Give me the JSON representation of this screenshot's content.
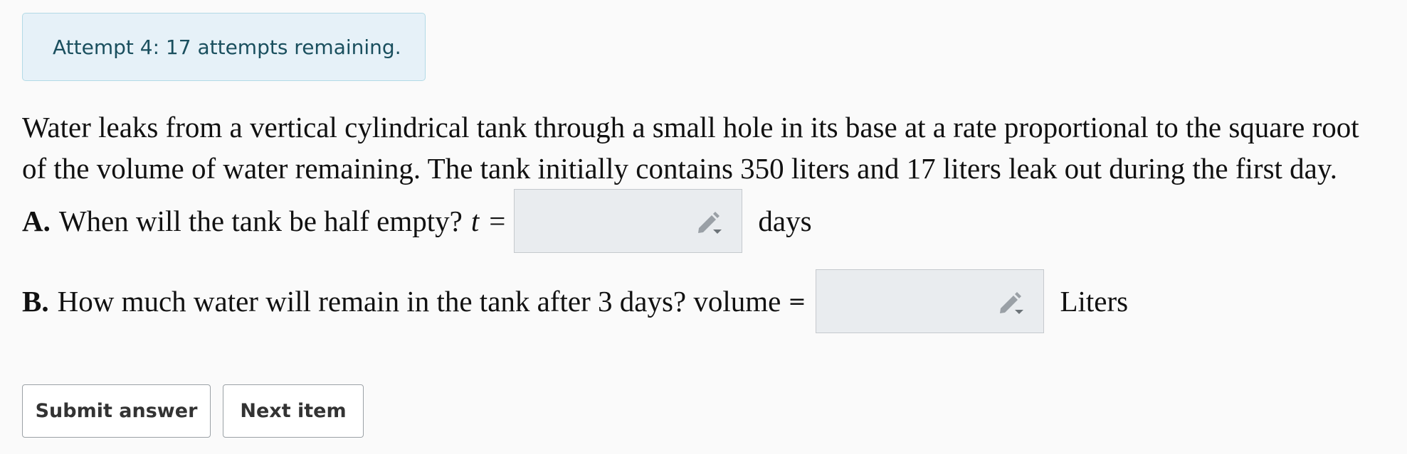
{
  "attempt_banner": {
    "text": "Attempt 4: 17 attempts remaining."
  },
  "problem": {
    "intro_line1": "Water leaks from a vertical cylindrical tank through a small hole in its base at a rate proportional to the square root",
    "intro_line2": "of the volume of water remaining. The tank initially contains 350 liters and 17 liters leak out during the first day.",
    "part_a": {
      "label": "A.",
      "question": "When will the tank be half empty?",
      "variable": "t",
      "equals": "=",
      "answer_value": "",
      "unit": "days"
    },
    "part_b": {
      "label": "B.",
      "question": "How much water will remain in the tank after 3 days? volume",
      "equals": "=",
      "answer_value": "",
      "unit": "Liters"
    }
  },
  "icons": {
    "answer_box_icon": "pencil-dropdown-icon"
  },
  "buttons": {
    "submit": "Submit answer",
    "next": "Next item"
  },
  "colors": {
    "banner_bg": "#e6f1f8",
    "banner_border": "#b3dae6",
    "banner_text": "#1a4f5e",
    "answer_box_bg": "#e9ecef"
  }
}
